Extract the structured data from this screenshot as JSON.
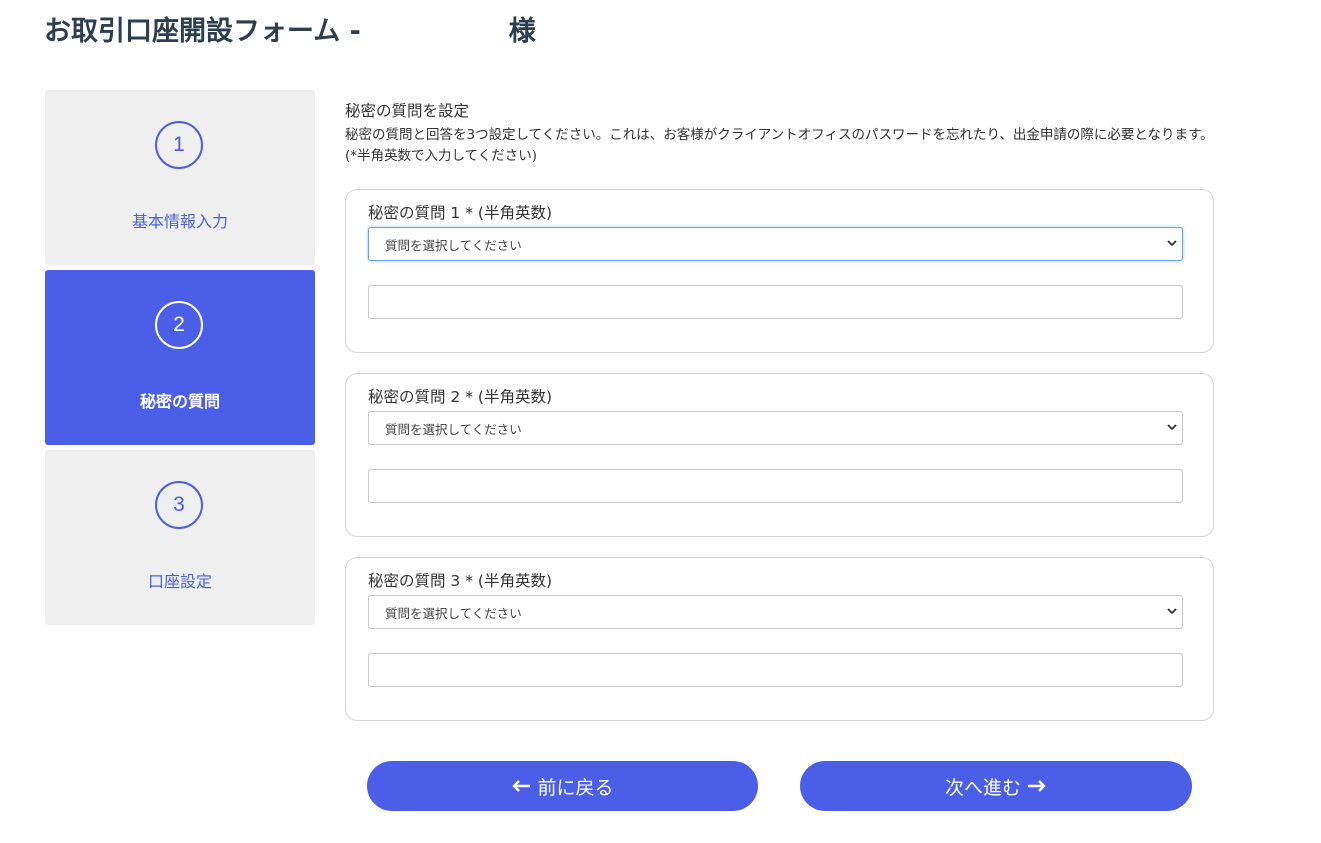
{
  "header": {
    "title": "お取引口座開設フォーム -",
    "suffix": "様"
  },
  "steps": [
    {
      "number": "1",
      "label": "基本情報入力",
      "active": false
    },
    {
      "number": "2",
      "label": "秘密の質問",
      "active": true
    },
    {
      "number": "3",
      "label": "口座設定",
      "active": false
    }
  ],
  "section": {
    "title": "秘密の質問を設定",
    "description": "秘密の質問と回答を3つ設定してください。これは、お客様がクライアントオフィスのパスワードを忘れたり、出金申請の際に必要となります。 (*半角英数で入力してください)"
  },
  "questions": [
    {
      "label": "秘密の質問 1 * (半角英数)",
      "select_value": "質問を選択してください",
      "answer_value": ""
    },
    {
      "label": "秘密の質問 2 * (半角英数)",
      "select_value": "質問を選択してください",
      "answer_value": ""
    },
    {
      "label": "秘密の質問 3 * (半角英数)",
      "select_value": "質問を選択してください",
      "answer_value": ""
    }
  ],
  "buttons": {
    "prev_label": "前に戻る",
    "next_label": "次へ進む"
  },
  "colors": {
    "accent": "#4a5ee8",
    "inactive_step_bg": "#efefef",
    "title_color": "#2d3e50"
  },
  "icons": {
    "prev": "arrow-left-icon",
    "next": "arrow-right-icon",
    "select": "chevron-down-icon"
  }
}
